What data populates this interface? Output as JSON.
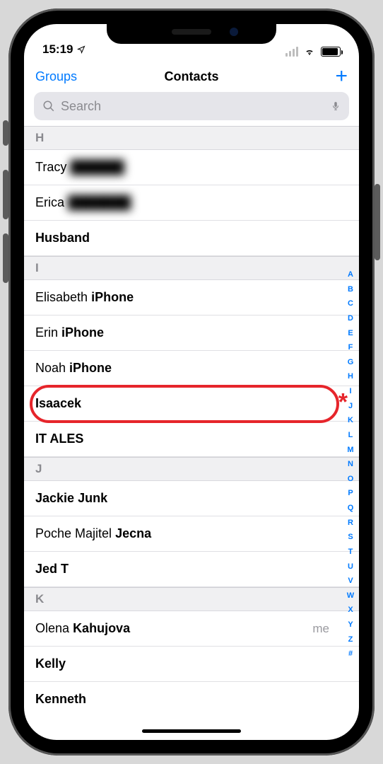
{
  "status": {
    "time": "15:19",
    "location_arrow": true
  },
  "nav": {
    "back_label": "Groups",
    "title": "Contacts",
    "add_label": "+"
  },
  "search": {
    "placeholder": "Search"
  },
  "sections": {
    "H": {
      "label": "H"
    },
    "I": {
      "label": "I"
    },
    "J": {
      "label": "J"
    },
    "K": {
      "label": "K"
    }
  },
  "contacts": {
    "h0_first": "Tracy",
    "h0_last_masked": "██████",
    "h1_first": "Erica",
    "h1_last_masked": "███████",
    "h2_full": "Husband",
    "i0_first": "Elisabeth",
    "i0_last": "iPhone",
    "i1_first": "Erin",
    "i1_last": "iPhone",
    "i2_first": "Noah",
    "i2_last": "iPhone",
    "i3_full": "Isaacek",
    "i4_full": "IT ALES",
    "j0_first": "Jackie",
    "j0_last": "Junk",
    "j1_first": "Poche Majitel",
    "j1_last": "Jecna",
    "j2_full": "Jed T",
    "k0_first": "Olena",
    "k0_last": "Kahujova",
    "k0_me": "me",
    "k1_full": "Kelly",
    "k2_full": "Kenneth"
  },
  "index": [
    "A",
    "B",
    "C",
    "D",
    "E",
    "F",
    "G",
    "H",
    "I",
    "J",
    "K",
    "L",
    "M",
    "N",
    "O",
    "P",
    "Q",
    "R",
    "S",
    "T",
    "U",
    "V",
    "W",
    "X",
    "Y",
    "Z",
    "#"
  ],
  "annotation": {
    "asterisk": "*",
    "highlighted_contact": "Isaacek"
  }
}
